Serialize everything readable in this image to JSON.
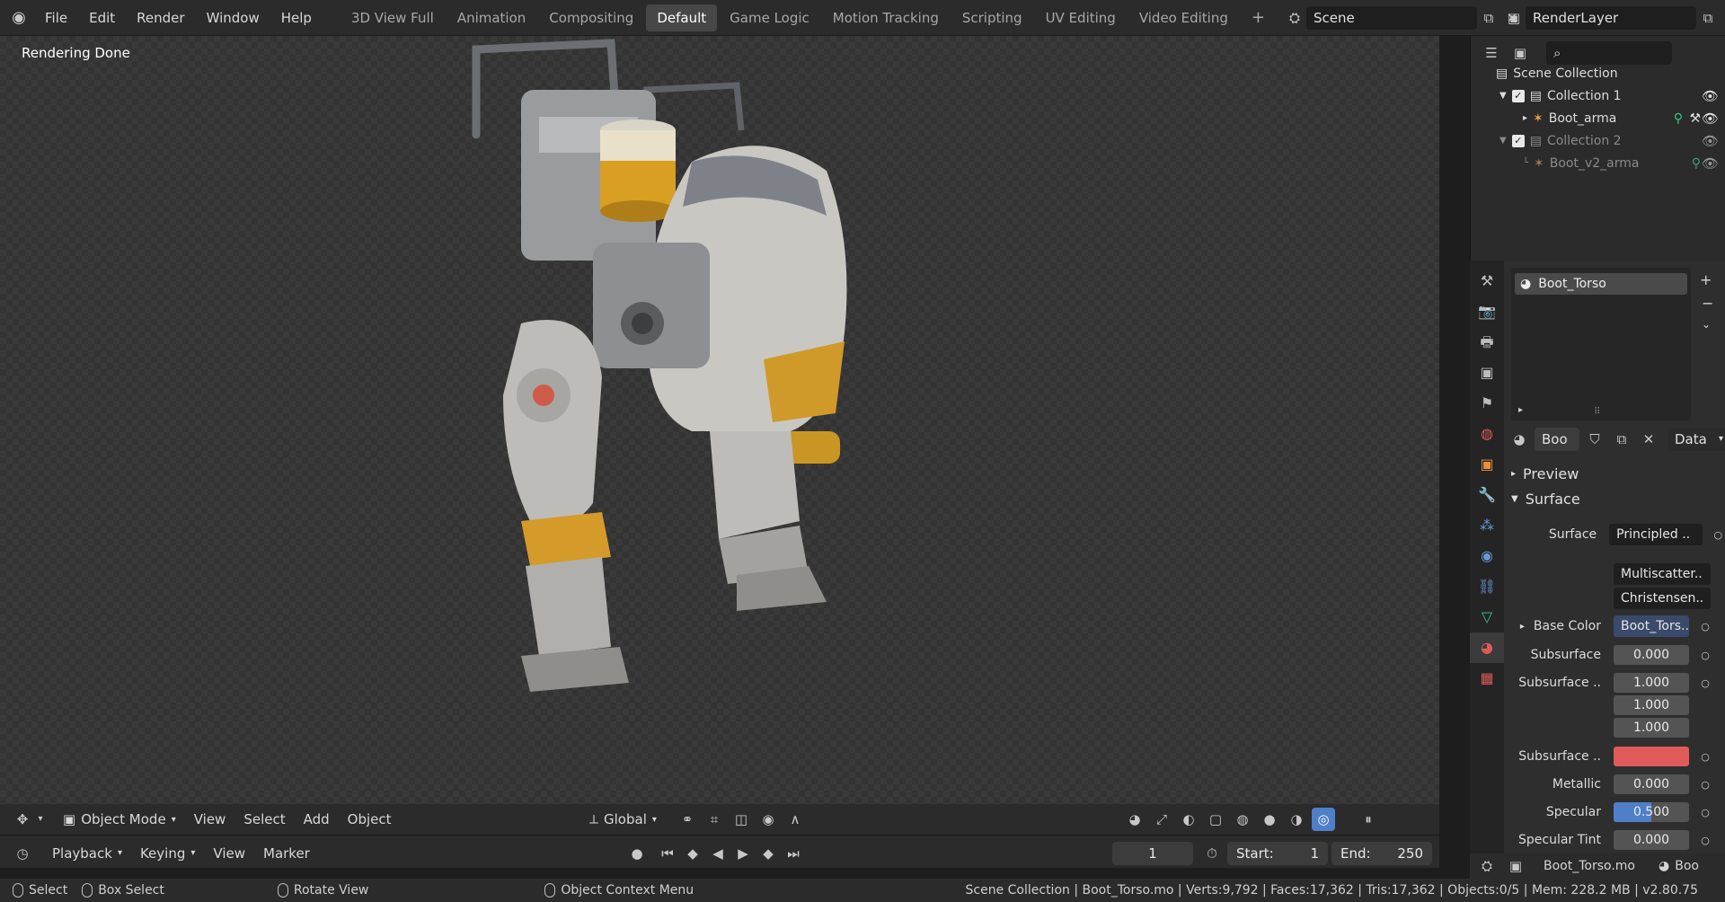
{
  "menu": [
    "File",
    "Edit",
    "Render",
    "Window",
    "Help"
  ],
  "workspaces": [
    {
      "label": "3D View Full",
      "active": false
    },
    {
      "label": "Animation",
      "active": false
    },
    {
      "label": "Compositing",
      "active": false
    },
    {
      "label": "Default",
      "active": true
    },
    {
      "label": "Game Logic",
      "active": false
    },
    {
      "label": "Motion Tracking",
      "active": false
    },
    {
      "label": "Scripting",
      "active": false
    },
    {
      "label": "UV Editing",
      "active": false
    },
    {
      "label": "Video Editing",
      "active": false
    }
  ],
  "add_workspace": "+",
  "scene": {
    "name": "Scene"
  },
  "view_layer": {
    "name": "RenderLayer"
  },
  "viewport": {
    "status": "Rendering Done",
    "header": {
      "mode": "Object Mode",
      "menus": [
        "View",
        "Select",
        "Add",
        "Object"
      ],
      "transform_orientation": "Global"
    }
  },
  "timeline": {
    "menus": [
      "Playback",
      "Keying",
      "View",
      "Marker"
    ],
    "current_frame": "1",
    "start_label": "Start:",
    "start": "1",
    "end_label": "End:",
    "end": "250"
  },
  "outliner": {
    "root": "Scene Collection",
    "items": [
      {
        "label": "Collection 1",
        "type": "collection",
        "dim": false
      },
      {
        "label": "Boot_arma",
        "type": "armature",
        "dim": false
      },
      {
        "label": "Collection 2",
        "type": "collection",
        "dim": true
      },
      {
        "label": "Boot_v2_arma",
        "type": "armature",
        "dim": true
      }
    ]
  },
  "material": {
    "slot": "Boot_Torso",
    "name_short": "Boo",
    "link": "Data",
    "panels": {
      "preview": "Preview",
      "surface": "Surface"
    },
    "surface_shader": "Principled ..",
    "subsurface_method": "Multiscatter..",
    "distribution": "Christensen..",
    "properties": [
      {
        "label": "Base Color",
        "value": "Boot_Tors..",
        "kind": "link"
      },
      {
        "label": "Subsurface",
        "value": "0.000",
        "kind": "value"
      },
      {
        "label": "Subsurface ..",
        "value": "1.000",
        "kind": "value"
      },
      {
        "label": "",
        "value": "1.000",
        "kind": "value"
      },
      {
        "label": "",
        "value": "1.000",
        "kind": "value"
      },
      {
        "label": "Subsurface ..",
        "value": "",
        "kind": "color"
      },
      {
        "label": "Metallic",
        "value": "0.000",
        "kind": "value"
      },
      {
        "label": "Specular",
        "value": "0.500",
        "kind": "slider",
        "fraction": 0.5
      },
      {
        "label": "Specular Tint",
        "value": "0.000",
        "kind": "value"
      }
    ],
    "subsurface_color": "#e05a5a",
    "accent": "#4f7fc9"
  },
  "props_footer": {
    "object": "Boot_Torso.mo",
    "extra": "Boo"
  },
  "statusbar": {
    "select": "Select",
    "box_select": "Box Select",
    "rotate": "Rotate View",
    "context_menu": "Object Context Menu",
    "stats": "Scene Collection | Boot_Torso.mo | Verts:9,792 | Faces:17,362 | Tris:17,362 | Objects:0/5 | Mem: 228.2 MB | v2.80.75"
  }
}
